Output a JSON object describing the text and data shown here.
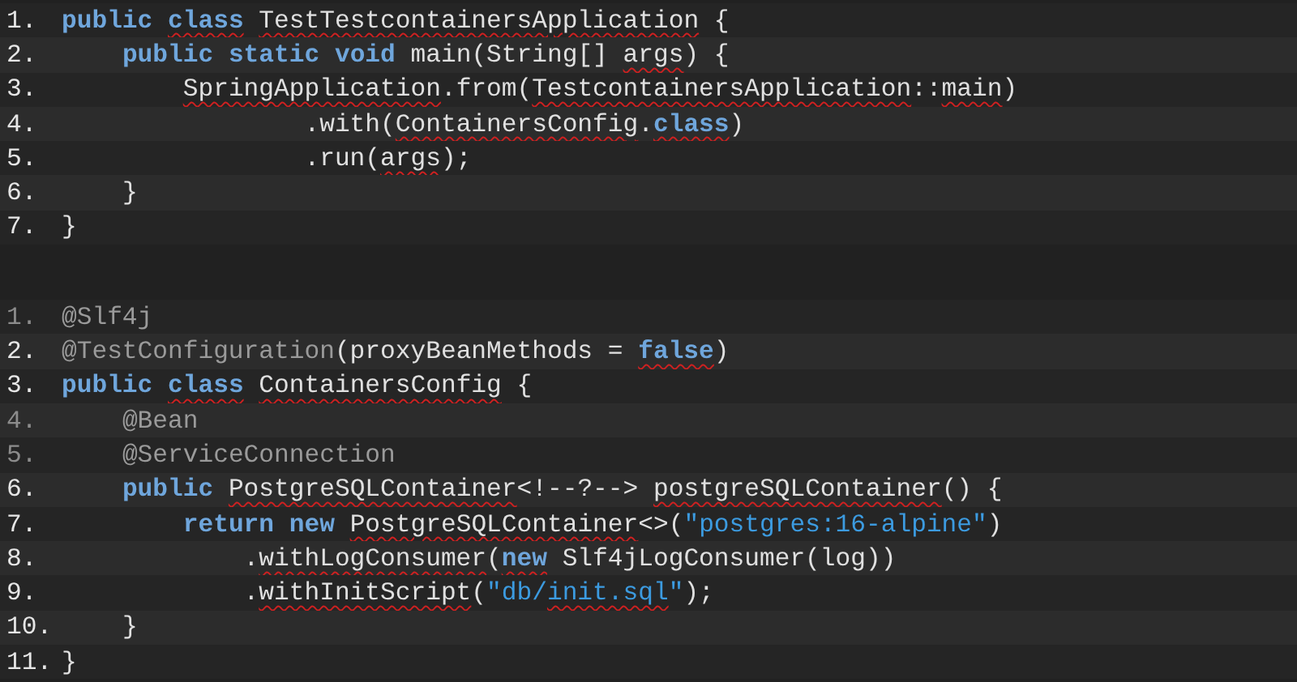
{
  "code_blocks": [
    {
      "lines": [
        {
          "number": "1.",
          "dim": false,
          "tokens": [
            {
              "text": "public",
              "kind": "keyword",
              "squiggle": false
            },
            {
              "text": " class",
              "kind": "keyword",
              "squiggle": true
            },
            {
              "text": " TestTestcontainersApplication",
              "kind": "plain",
              "squiggle": true
            },
            {
              "text": " {",
              "kind": "plain",
              "squiggle": false
            }
          ]
        },
        {
          "number": "2.",
          "dim": false,
          "tokens": [
            {
              "text": "    public",
              "kind": "keyword",
              "squiggle": false
            },
            {
              "text": " static",
              "kind": "keyword",
              "squiggle": false
            },
            {
              "text": " void",
              "kind": "keyword",
              "squiggle": false
            },
            {
              "text": " main(String[] ",
              "kind": "plain",
              "squiggle": false
            },
            {
              "text": "args",
              "kind": "plain",
              "squiggle": true
            },
            {
              "text": ") {",
              "kind": "plain",
              "squiggle": false
            }
          ]
        },
        {
          "number": "3.",
          "dim": false,
          "tokens": [
            {
              "text": "        SpringApplication",
              "kind": "plain",
              "squiggle": true
            },
            {
              "text": ".from(",
              "kind": "plain",
              "squiggle": false
            },
            {
              "text": "TestcontainersApplication",
              "kind": "plain",
              "squiggle": true
            },
            {
              "text": "::",
              "kind": "plain",
              "squiggle": false
            },
            {
              "text": "main",
              "kind": "plain",
              "squiggle": true
            },
            {
              "text": ")",
              "kind": "plain",
              "squiggle": false
            }
          ]
        },
        {
          "number": "4.",
          "dim": false,
          "tokens": [
            {
              "text": "                .with(",
              "kind": "plain",
              "squiggle": false
            },
            {
              "text": "ContainersConfig",
              "kind": "plain",
              "squiggle": true
            },
            {
              "text": ".",
              "kind": "plain",
              "squiggle": false
            },
            {
              "text": "class",
              "kind": "keyword",
              "squiggle": true
            },
            {
              "text": ")",
              "kind": "plain",
              "squiggle": false
            }
          ]
        },
        {
          "number": "5.",
          "dim": false,
          "tokens": [
            {
              "text": "                .run(",
              "kind": "plain",
              "squiggle": false
            },
            {
              "text": "args",
              "kind": "plain",
              "squiggle": true
            },
            {
              "text": ");",
              "kind": "plain",
              "squiggle": false
            }
          ]
        },
        {
          "number": "6.",
          "dim": false,
          "tokens": [
            {
              "text": "    }",
              "kind": "plain",
              "squiggle": false
            }
          ]
        },
        {
          "number": "7.",
          "dim": false,
          "tokens": [
            {
              "text": "}",
              "kind": "plain",
              "squiggle": false
            }
          ]
        }
      ]
    },
    {
      "lines": [
        {
          "number": "1.",
          "dim": true,
          "tokens": [
            {
              "text": "@Slf4j",
              "kind": "annotation",
              "squiggle": false
            }
          ]
        },
        {
          "number": "2.",
          "dim": false,
          "tokens": [
            {
              "text": "@TestConfiguration",
              "kind": "annotation",
              "squiggle": false
            },
            {
              "text": "(proxyBeanMethods = ",
              "kind": "plain",
              "squiggle": false
            },
            {
              "text": "false",
              "kind": "keyword",
              "squiggle": true
            },
            {
              "text": ")",
              "kind": "plain",
              "squiggle": false
            }
          ]
        },
        {
          "number": "3.",
          "dim": false,
          "tokens": [
            {
              "text": "public",
              "kind": "keyword",
              "squiggle": false
            },
            {
              "text": " class",
              "kind": "keyword",
              "squiggle": true
            },
            {
              "text": " ContainersConfig",
              "kind": "plain",
              "squiggle": true
            },
            {
              "text": " {",
              "kind": "plain",
              "squiggle": false
            }
          ]
        },
        {
          "number": "4.",
          "dim": true,
          "tokens": [
            {
              "text": "    @Bean",
              "kind": "annotation",
              "squiggle": false
            }
          ]
        },
        {
          "number": "5.",
          "dim": true,
          "tokens": [
            {
              "text": "    @ServiceConnection",
              "kind": "annotation",
              "squiggle": false
            }
          ]
        },
        {
          "number": "6.",
          "dim": false,
          "tokens": [
            {
              "text": "    public",
              "kind": "keyword",
              "squiggle": false
            },
            {
              "text": " PostgreSQLContainer",
              "kind": "plain",
              "squiggle": true
            },
            {
              "text": "<!--?--> ",
              "kind": "plain",
              "squiggle": false
            },
            {
              "text": "postgreSQLContainer",
              "kind": "plain",
              "squiggle": true
            },
            {
              "text": "() {",
              "kind": "plain",
              "squiggle": false
            }
          ]
        },
        {
          "number": "7.",
          "dim": false,
          "tokens": [
            {
              "text": "        return",
              "kind": "keyword",
              "squiggle": false
            },
            {
              "text": " new",
              "kind": "keyword",
              "squiggle": false
            },
            {
              "text": " PostgreSQLContainer",
              "kind": "plain",
              "squiggle": true
            },
            {
              "text": "<>(",
              "kind": "plain",
              "squiggle": false
            },
            {
              "text": "\"postgres:16-alpine\"",
              "kind": "string",
              "squiggle": false
            },
            {
              "text": ")",
              "kind": "plain",
              "squiggle": false
            }
          ]
        },
        {
          "number": "8.",
          "dim": false,
          "tokens": [
            {
              "text": "            .",
              "kind": "plain",
              "squiggle": false
            },
            {
              "text": "withLogConsumer",
              "kind": "plain",
              "squiggle": true
            },
            {
              "text": "(",
              "kind": "plain",
              "squiggle": false
            },
            {
              "text": "new",
              "kind": "keyword",
              "squiggle": true
            },
            {
              "text": " Slf4jLogConsumer(log))",
              "kind": "plain",
              "squiggle": false
            }
          ]
        },
        {
          "number": "9.",
          "dim": false,
          "tokens": [
            {
              "text": "            .",
              "kind": "plain",
              "squiggle": false
            },
            {
              "text": "withInitScript",
              "kind": "plain",
              "squiggle": true
            },
            {
              "text": "(",
              "kind": "plain",
              "squiggle": false
            },
            {
              "text": "\"db/",
              "kind": "string",
              "squiggle": false
            },
            {
              "text": "init.sql",
              "kind": "string",
              "squiggle": true
            },
            {
              "text": "\"",
              "kind": "string",
              "squiggle": false
            },
            {
              "text": ");",
              "kind": "plain",
              "squiggle": false
            }
          ]
        },
        {
          "number": "10.",
          "dim": false,
          "tokens": [
            {
              "text": "    }",
              "kind": "plain",
              "squiggle": false
            }
          ]
        },
        {
          "number": "11.",
          "dim": false,
          "tokens": [
            {
              "text": "}",
              "kind": "plain",
              "squiggle": false
            }
          ]
        }
      ]
    }
  ]
}
